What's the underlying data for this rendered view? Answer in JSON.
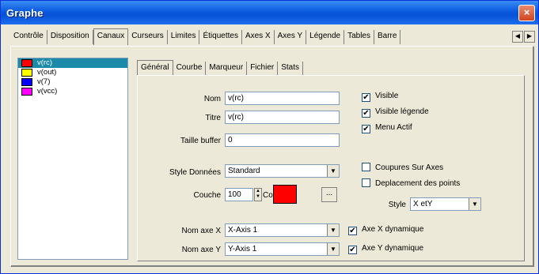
{
  "window": {
    "title": "Graphe",
    "close_label": "×"
  },
  "tabs": [
    "Contrôle",
    "Disposition",
    "Canaux",
    "Curseurs",
    "Limites",
    "Étiquettes",
    "Axes X",
    "Axes Y",
    "Légende",
    "Tables",
    "Barre"
  ],
  "tab_scroll": {
    "left": "◀",
    "right": "▶"
  },
  "channels": [
    {
      "label": "v(rc)",
      "color": "#ff0000"
    },
    {
      "label": "v(out)",
      "color": "#ffff00"
    },
    {
      "label": "v(7)",
      "color": "#0000ff"
    },
    {
      "label": "v(vcc)",
      "color": "#ff00ff"
    }
  ],
  "subtabs": [
    "Général",
    "Courbe",
    "Marqueur",
    "Fichier",
    "Stats"
  ],
  "general": {
    "nom_label": "Nom",
    "nom_value": "v(rc)",
    "titre_label": "Titre",
    "titre_value": "v(rc)",
    "taille_label": "Taille buffer",
    "taille_value": "0",
    "style_label": "Style Données",
    "style_value": "Standard",
    "couche_label": "Couche",
    "couche_value": "100",
    "couleur_label": "Couleur",
    "couleur_value": "#ff0000",
    "dots_label": "...",
    "nomx_label": "Nom axe X",
    "nomx_value": "X-Axis 1",
    "nomy_label": "Nom axe Y",
    "nomy_value": "Y-Axis 1",
    "style2_label": "Style",
    "style2_value": "X etY"
  },
  "checks": {
    "visible": {
      "label": "Visible",
      "checked": true
    },
    "visible_legende": {
      "label": "Visible légende",
      "checked": true
    },
    "menu_actif": {
      "label": "Menu Actif",
      "checked": true
    },
    "coupures": {
      "label": "Coupures Sur Axes",
      "checked": false
    },
    "deplacement": {
      "label": "Deplacement des points",
      "checked": false
    },
    "axex_dyn": {
      "label": "Axe X dynamique",
      "checked": true
    },
    "axey_dyn": {
      "label": "Axe Y dynamique",
      "checked": true
    }
  }
}
